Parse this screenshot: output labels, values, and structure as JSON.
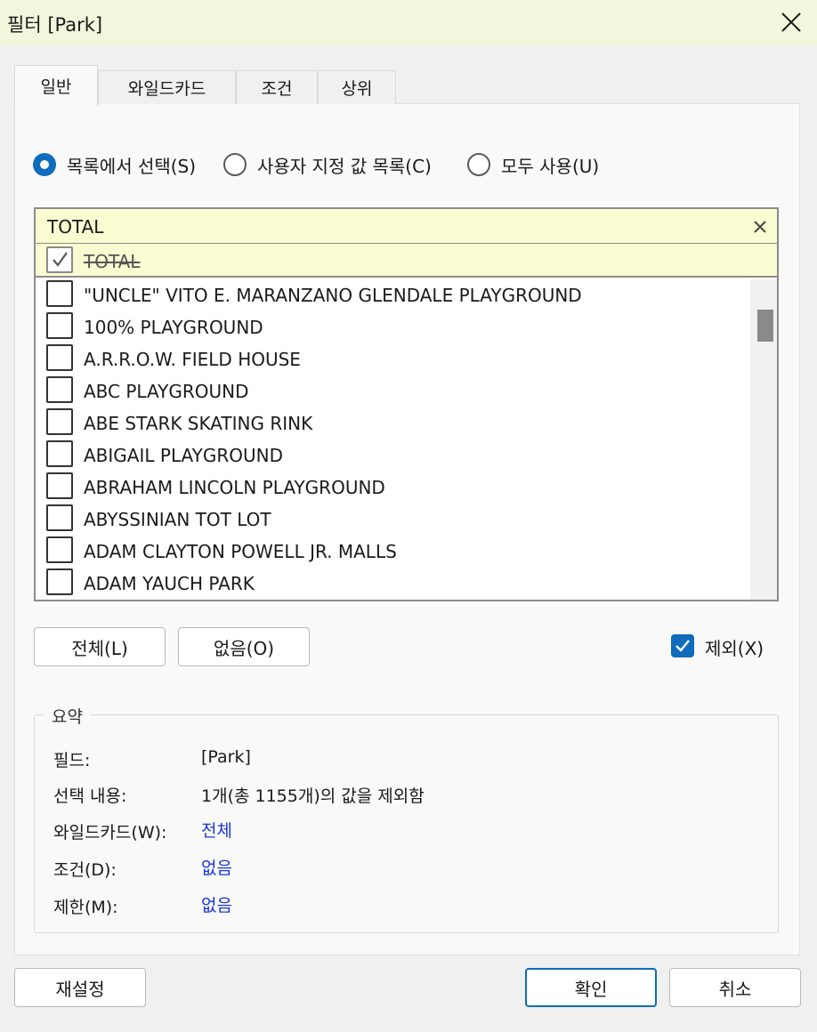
{
  "window": {
    "title": "필터 [Park]"
  },
  "tabs": [
    {
      "label": "일반",
      "active": true
    },
    {
      "label": "와일드카드",
      "active": false
    },
    {
      "label": "조건",
      "active": false
    },
    {
      "label": "상위",
      "active": false
    }
  ],
  "selection_mode": {
    "options": [
      {
        "label": "목록에서 선택(S)",
        "selected": true
      },
      {
        "label": "사용자 지정 값 목록(C)",
        "selected": false
      },
      {
        "label": "모두 사용(U)",
        "selected": false
      }
    ]
  },
  "search": {
    "value": "TOTAL"
  },
  "list": {
    "items": [
      {
        "label": "TOTAL",
        "checked": true,
        "excluded": true
      },
      {
        "label": "\"UNCLE\" VITO E. MARANZANO GLENDALE PLAYGROUND",
        "checked": false
      },
      {
        "label": "100% PLAYGROUND",
        "checked": false
      },
      {
        "label": "A.R.R.O.W. FIELD HOUSE",
        "checked": false
      },
      {
        "label": "ABC PLAYGROUND",
        "checked": false
      },
      {
        "label": "ABE STARK SKATING RINK",
        "checked": false
      },
      {
        "label": "ABIGAIL PLAYGROUND",
        "checked": false
      },
      {
        "label": "ABRAHAM LINCOLN PLAYGROUND",
        "checked": false
      },
      {
        "label": "ABYSSINIAN TOT LOT",
        "checked": false
      },
      {
        "label": "ADAM CLAYTON POWELL JR. MALLS",
        "checked": false
      },
      {
        "label": "ADAM YAUCH PARK",
        "checked": false
      }
    ]
  },
  "actions": {
    "all_label": "전체(L)",
    "none_label": "없음(O)"
  },
  "exclude": {
    "label": "제외(X)",
    "checked": true
  },
  "summary": {
    "legend": "요약",
    "rows": [
      {
        "key": "필드:",
        "value": "[Park]",
        "link": false
      },
      {
        "key": "선택 내용:",
        "value": "1개(총 1155개)의 값을 제외함",
        "link": false
      },
      {
        "key": "와일드카드(W):",
        "value": "전체",
        "link": true
      },
      {
        "key": "조건(D):",
        "value": "없음",
        "link": true
      },
      {
        "key": "제한(M):",
        "value": "없음",
        "link": true
      }
    ]
  },
  "footer": {
    "reset_label": "재설정",
    "ok_label": "확인",
    "cancel_label": "취소"
  },
  "colors": {
    "accent": "#0f6cbd",
    "link": "#1a36d9",
    "title_bg": "#f1f6dc",
    "highlight_bg": "#fbfbd1"
  }
}
